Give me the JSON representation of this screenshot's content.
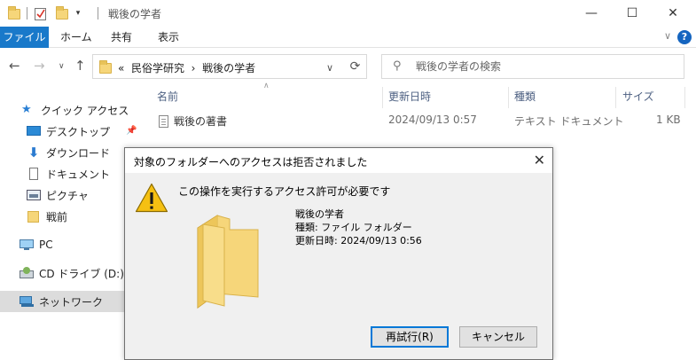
{
  "window": {
    "title": "戦後の学者"
  },
  "ribbon": {
    "tabs": [
      "ファイル",
      "ホーム",
      "共有",
      "表示"
    ],
    "help": "?"
  },
  "address": {
    "prefix": "«",
    "path1": "民俗学研究",
    "separator": "›",
    "path2": "戦後の学者"
  },
  "search": {
    "placeholder": "戦後の学者の検索"
  },
  "nav": {
    "quick_access": "クイック アクセス",
    "items": [
      "デスクトップ",
      "ダウンロード",
      "ドキュメント",
      "ピクチャ",
      "戦前"
    ],
    "pc": "PC",
    "cd_drive": "CD ドライブ (D:) SSS",
    "network": "ネットワーク"
  },
  "columns": {
    "name": "名前",
    "date": "更新日時",
    "type": "種類",
    "size": "サイズ"
  },
  "files": [
    {
      "name": "戦後の著書",
      "date": "2024/09/13 0:57",
      "type": "テキスト ドキュメント",
      "size": "1 KB"
    }
  ],
  "dialog": {
    "title": "対象のフォルダーへのアクセスは拒否されました",
    "message": "この操作を実行するアクセス許可が必要です",
    "folder_name": "戦後の学者",
    "folder_type": "種類: ファイル フォルダー",
    "folder_date": "更新日時: 2024/09/13 0:56",
    "retry": "再試行(R)",
    "cancel": "キャンセル"
  },
  "colors": {
    "accent": "#1979ca",
    "folder": "#f6d67a",
    "warning": "#f5c012"
  }
}
